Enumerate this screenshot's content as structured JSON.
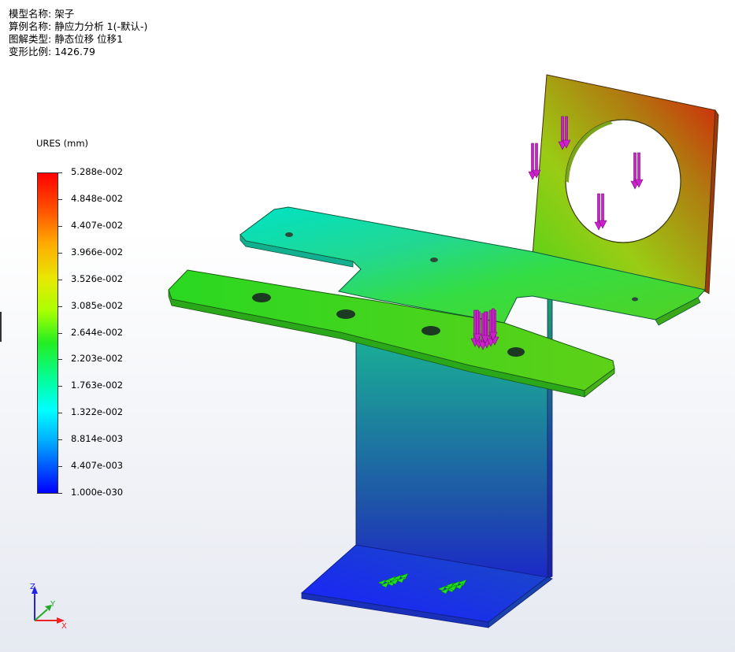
{
  "header": [
    {
      "label": "模型名称:",
      "value": "架子"
    },
    {
      "label": "算例名称:",
      "value": "静应力分析 1(-默认-)"
    },
    {
      "label": "图解类型:",
      "value": "静态位移 位移1"
    },
    {
      "label": "变形比例:",
      "value": "1426.79"
    }
  ],
  "legend": {
    "title": "URES (mm)",
    "ticks": [
      "5.288e-002",
      "4.848e-002",
      "4.407e-002",
      "3.966e-002",
      "3.526e-002",
      "3.085e-002",
      "2.644e-002",
      "2.203e-002",
      "1.763e-002",
      "1.322e-002",
      "8.814e-003",
      "4.407e-003",
      "1.000e-030"
    ]
  },
  "triad": {
    "x": "X",
    "y": "Y",
    "z": "Z"
  },
  "colors": {
    "load_arrows": "#cc22cc",
    "fixtures": "#22dd22"
  }
}
